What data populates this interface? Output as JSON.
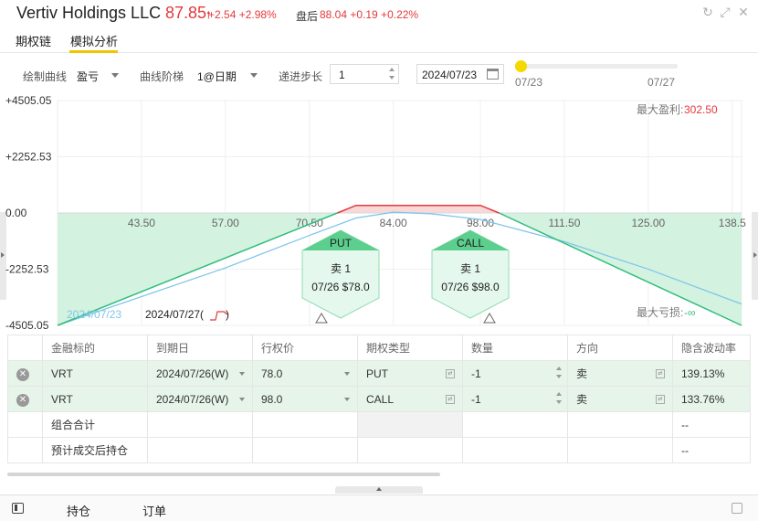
{
  "header": {
    "name": "Vertiv Holdings LLC",
    "price": "87.85",
    "change": "+2.54 +2.98%",
    "after_hours_label": "盘后",
    "after_hours": "88.04 +0.19 +0.22%",
    "price_arrow": "arrow-up-icon",
    "window_buttons": [
      "refresh-icon",
      "expand-icon",
      "close-icon"
    ]
  },
  "tabs": [
    {
      "label": "期权链",
      "active": false
    },
    {
      "label": "模拟分析",
      "active": true
    }
  ],
  "controls": {
    "curve_label": "绘制曲线",
    "curve_value": "盈亏",
    "ladder_label": "曲线阶梯",
    "ladder_value": "1@日期",
    "step_label": "递进步长",
    "step_value": "1",
    "date_value": "2024/07/23",
    "slider_start": "07/23",
    "slider_end": "07/27",
    "slider_position": 0
  },
  "chart": {
    "y_ticks": [
      "+4505.05",
      "+2252.53",
      "0.00",
      "-2252.53",
      "-4505.05"
    ],
    "x_ticks": [
      "43.50",
      "57.00",
      "70.50",
      "84.00",
      "98.00",
      "111.50",
      "125.00",
      "138.5"
    ],
    "max_profit_label": "最大盈利:",
    "max_profit_value": "302.50",
    "max_loss_label": "最大亏损:",
    "max_loss_value": "-∞",
    "legend_curve_date": "2024/07/23",
    "legend_expiry_date": "2024/07/27(",
    "legend_expiry_suffix": ")",
    "put_marker": {
      "type": "PUT",
      "action": "卖 1",
      "detail": "07/26 $78.0"
    },
    "call_marker": {
      "type": "CALL",
      "action": "卖 1",
      "detail": "07/26 $98.0"
    },
    "colors": {
      "profit": "#e4393c",
      "loss_fill": "#d4f2e0",
      "expiry_line": "#2fbd7c",
      "curve_line": "#7fc6ea",
      "marker": "#5ccf8e"
    }
  },
  "chart_data": {
    "type": "line",
    "title": "",
    "xlabel": "",
    "ylabel": "",
    "xlim": [
      30,
      140
    ],
    "ylim": [
      -4505.05,
      4505.05
    ],
    "series": [
      {
        "name": "2024/07/27",
        "x": [
          30,
          75,
          78,
          98,
          101,
          140
        ],
        "y": [
          -4505.05,
          0,
          302.5,
          302.5,
          0,
          -4505.05
        ]
      },
      {
        "name": "2024/07/23",
        "x": [
          30,
          57,
          70.5,
          78,
          84,
          90,
          98,
          111.5,
          125,
          140
        ],
        "y": [
          -4505.05,
          -2200,
          -900,
          -200,
          30,
          -30,
          -260,
          -1150,
          -2250,
          -3650
        ]
      }
    ]
  },
  "table": {
    "headers": [
      "",
      "金融标的",
      "到期日",
      "行权价",
      "期权类型",
      "数量",
      "方向",
      "隐含波动率"
    ],
    "rows": [
      {
        "symbol": "VRT",
        "expiry": "2024/07/26(W)",
        "strike": "78.0",
        "type": "PUT",
        "qty": "-1",
        "side": "卖",
        "iv": "139.13%"
      },
      {
        "symbol": "VRT",
        "expiry": "2024/07/26(W)",
        "strike": "98.0",
        "type": "CALL",
        "qty": "-1",
        "side": "卖",
        "iv": "133.76%"
      }
    ],
    "summary_label": "组合合计",
    "summary_iv": "--",
    "post_label": "预计成交后持仓",
    "post_iv": "--"
  },
  "bottom": {
    "panel_icon": "panel-toggle-icon",
    "tabs": [
      "持仓",
      "订单"
    ],
    "copy_icon": "copy-icon"
  }
}
